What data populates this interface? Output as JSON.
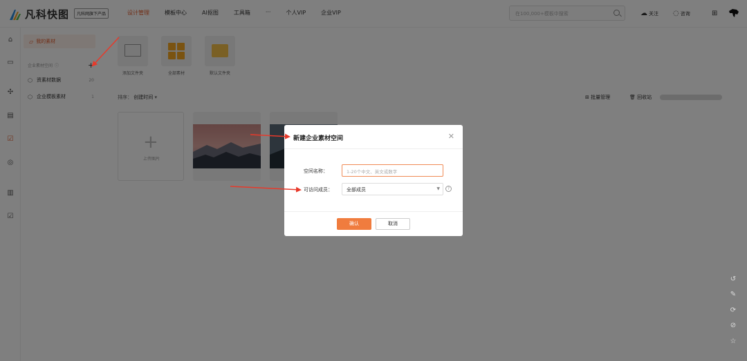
{
  "header": {
    "logo_text": "凡科快图",
    "logo_badge": "凡科网旗下产品",
    "nav": [
      "设计管理",
      "模板中心",
      "AI抠图",
      "工具箱",
      "···",
      "个人VIP",
      "企业VIP"
    ],
    "active_nav_index": 0,
    "search_placeholder": "在100,000+模板中搜索",
    "follow_label": "关注",
    "consult_label": "咨询"
  },
  "sidebar": {
    "my_materials": "我的素材",
    "enterprise_header": "企业素材空间",
    "items": [
      {
        "label": "资素材数据",
        "count": "20"
      },
      {
        "label": "企业模板素材",
        "count": "1"
      }
    ]
  },
  "main": {
    "tiles": [
      "添加文件夹",
      "全部素材",
      "默认文件夹"
    ],
    "sort_prefix": "排序：",
    "sort_value": "创建时间",
    "batch_label": "批量管理",
    "recycle_label": "回收站",
    "upload_label": "上传图片"
  },
  "modal": {
    "title": "新建企业素材空间",
    "name_label": "空间名称：",
    "name_placeholder": "1-20个中文、英文或数字",
    "access_label": "可访问成员：",
    "access_value": "全部成员",
    "confirm": "确认",
    "cancel": "取消"
  },
  "colors": {
    "accent": "#e05a2b",
    "confirm_button": "#f07c3e",
    "arrow": "#e8392a"
  }
}
